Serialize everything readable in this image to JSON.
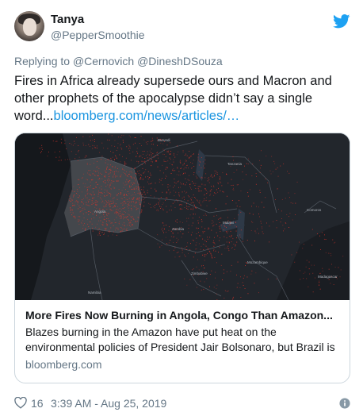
{
  "user": {
    "name": "Tanya",
    "handle": "@PepperSmoothie"
  },
  "reply": {
    "prefix": "Replying to",
    "mention1": "@Cernovich",
    "mention2": "@DineshDSouza"
  },
  "tweet": {
    "text": "Fires in Africa already supersede ours and Macron and other prophets of the apocalypse didn’t say a single word...",
    "link": "bloomberg.com/news/articles/…"
  },
  "card": {
    "title": "More Fires Now Burning in Angola, Congo Than Amazon...",
    "description": "Blazes burning in the Amazon have put heat on the environmental policies of President Jair Bolsonaro, but Brazil is",
    "domain": "bloomberg.com",
    "map_labels": [
      "Burundi",
      "Tanzania",
      "Angola",
      "Zambia",
      "Malawi",
      "Comoros",
      "Mozambique",
      "Zimbabwe",
      "Madagascar",
      "Namibia"
    ]
  },
  "footer": {
    "likes": "16",
    "timestamp": "3:39 AM - Aug 25, 2019"
  },
  "colors": {
    "link": "#1b95e0",
    "twitter_blue": "#1da1f2",
    "secondary_text": "#657786",
    "fire": "#e0342a"
  },
  "icons": [
    "twitter-bird-icon",
    "heart-icon",
    "info-icon"
  ]
}
